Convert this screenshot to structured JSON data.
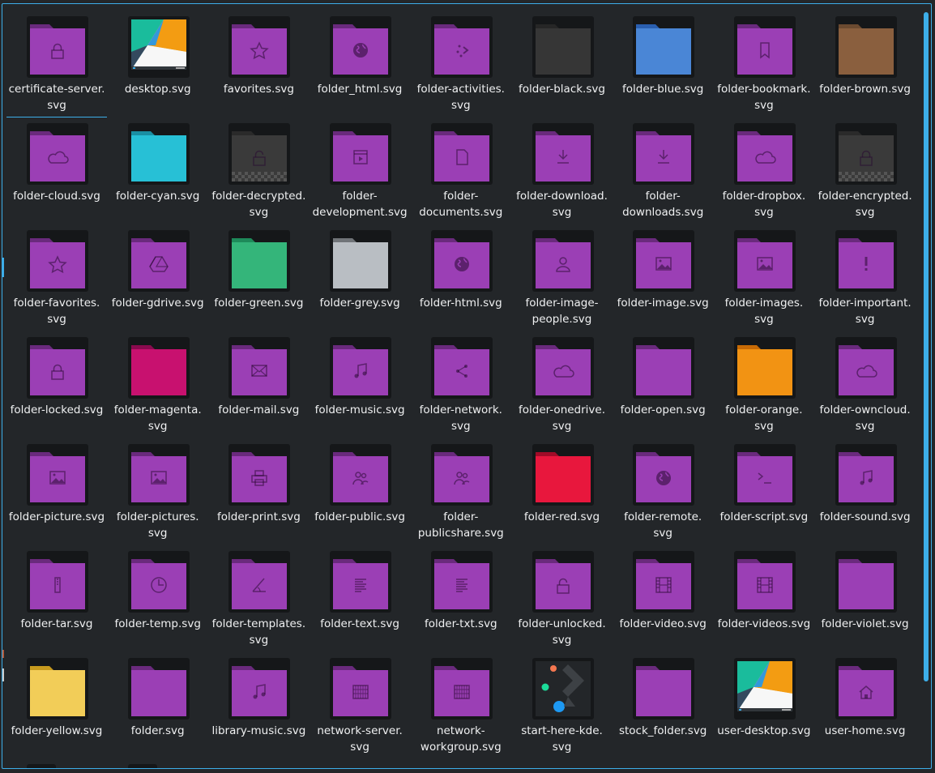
{
  "colors": {
    "accent": "#3daee9",
    "background": "#232629",
    "text": "#eff0f1",
    "violet_body": "#9b3fb5",
    "violet_tab": "#6a2a7d"
  },
  "icons": [
    {
      "label": "certificate-server.\nsvg",
      "icon": "lock",
      "color": "violet",
      "selected": true
    },
    {
      "label": "desktop.svg",
      "icon": "wallpaper"
    },
    {
      "label": "favorites.svg",
      "icon": "star",
      "color": "violet"
    },
    {
      "label": "folder_html.svg",
      "icon": "globe",
      "color": "violet"
    },
    {
      "label": "folder-activities.\nsvg",
      "icon": "activities",
      "color": "violet"
    },
    {
      "label": "folder-black.svg",
      "icon": "none",
      "color": "black"
    },
    {
      "label": "folder-blue.svg",
      "icon": "none",
      "color": "blue"
    },
    {
      "label": "folder-bookmark.\nsvg",
      "icon": "bookmark",
      "color": "violet"
    },
    {
      "label": "folder-brown.svg",
      "icon": "none",
      "color": "brown"
    },
    {
      "label": "folder-cloud.svg",
      "icon": "cloud",
      "color": "violet"
    },
    {
      "label": "folder-cyan.svg",
      "icon": "none",
      "color": "cyan"
    },
    {
      "label": "folder-decrypted.\nsvg",
      "icon": "unlock",
      "color": "checker"
    },
    {
      "label": "folder-\ndevelopment.svg",
      "icon": "development",
      "color": "violet"
    },
    {
      "label": "folder-\ndocuments.svg",
      "icon": "document",
      "color": "violet"
    },
    {
      "label": "folder-download.\nsvg",
      "icon": "download",
      "color": "violet"
    },
    {
      "label": "folder-\ndownloads.svg",
      "icon": "download",
      "color": "violet"
    },
    {
      "label": "folder-dropbox.\nsvg",
      "icon": "cloud",
      "color": "violet"
    },
    {
      "label": "folder-encrypted.\nsvg",
      "icon": "lock",
      "color": "checker"
    },
    {
      "label": "folder-favorites.\nsvg",
      "icon": "star",
      "color": "violet"
    },
    {
      "label": "folder-gdrive.svg",
      "icon": "gdrive",
      "color": "violet"
    },
    {
      "label": "folder-green.svg",
      "icon": "none",
      "color": "green"
    },
    {
      "label": "folder-grey.svg",
      "icon": "none",
      "color": "grey"
    },
    {
      "label": "folder-html.svg",
      "icon": "globe",
      "color": "violet"
    },
    {
      "label": "folder-image-\npeople.svg",
      "icon": "person",
      "color": "violet"
    },
    {
      "label": "folder-image.svg",
      "icon": "image",
      "color": "violet"
    },
    {
      "label": "folder-images.\nsvg",
      "icon": "image",
      "color": "violet"
    },
    {
      "label": "folder-important.\nsvg",
      "icon": "exclaim",
      "color": "violet"
    },
    {
      "label": "folder-locked.svg",
      "icon": "lock",
      "color": "violet"
    },
    {
      "label": "folder-magenta.\nsvg",
      "icon": "none",
      "color": "magenta"
    },
    {
      "label": "folder-mail.svg",
      "icon": "mail",
      "color": "violet"
    },
    {
      "label": "folder-music.svg",
      "icon": "music",
      "color": "violet"
    },
    {
      "label": "folder-network.\nsvg",
      "icon": "share",
      "color": "violet"
    },
    {
      "label": "folder-onedrive.\nsvg",
      "icon": "cloud",
      "color": "violet"
    },
    {
      "label": "folder-open.svg",
      "icon": "none",
      "color": "violet"
    },
    {
      "label": "folder-orange.\nsvg",
      "icon": "none",
      "color": "orange"
    },
    {
      "label": "folder-owncloud.\nsvg",
      "icon": "cloud",
      "color": "violet"
    },
    {
      "label": "folder-picture.svg",
      "icon": "image",
      "color": "violet"
    },
    {
      "label": "folder-pictures.\nsvg",
      "icon": "image",
      "color": "violet"
    },
    {
      "label": "folder-print.svg",
      "icon": "print",
      "color": "violet"
    },
    {
      "label": "folder-public.svg",
      "icon": "people",
      "color": "violet"
    },
    {
      "label": "folder-\npublicshare.svg",
      "icon": "people",
      "color": "violet"
    },
    {
      "label": "folder-red.svg",
      "icon": "none",
      "color": "red"
    },
    {
      "label": "folder-remote.\nsvg",
      "icon": "globe",
      "color": "violet"
    },
    {
      "label": "folder-script.svg",
      "icon": "terminal",
      "color": "violet"
    },
    {
      "label": "folder-sound.svg",
      "icon": "music",
      "color": "violet"
    },
    {
      "label": "folder-tar.svg",
      "icon": "zip",
      "color": "violet"
    },
    {
      "label": "folder-temp.svg",
      "icon": "clock",
      "color": "violet"
    },
    {
      "label": "folder-templates.\nsvg",
      "icon": "template",
      "color": "violet"
    },
    {
      "label": "folder-text.svg",
      "icon": "text",
      "color": "violet"
    },
    {
      "label": "folder-txt.svg",
      "icon": "text",
      "color": "violet"
    },
    {
      "label": "folder-unlocked.\nsvg",
      "icon": "unlock",
      "color": "violet"
    },
    {
      "label": "folder-video.svg",
      "icon": "film",
      "color": "violet"
    },
    {
      "label": "folder-videos.svg",
      "icon": "film",
      "color": "violet"
    },
    {
      "label": "folder-violet.svg",
      "icon": "none",
      "color": "violet"
    },
    {
      "label": "folder-yellow.svg",
      "icon": "none",
      "color": "yellow"
    },
    {
      "label": "folder.svg",
      "icon": "none",
      "color": "violet"
    },
    {
      "label": "library-music.svg",
      "icon": "music",
      "color": "violet"
    },
    {
      "label": "network-server.\nsvg",
      "icon": "server",
      "color": "violet"
    },
    {
      "label": "network-\nworkgroup.svg",
      "icon": "server",
      "color": "violet"
    },
    {
      "label": "start-here-kde.\nsvg",
      "icon": "kde"
    },
    {
      "label": "stock_folder.svg",
      "icon": "none",
      "color": "violet"
    },
    {
      "label": "user-desktop.svg",
      "icon": "wallpaper"
    },
    {
      "label": "user-home.svg",
      "icon": "home",
      "color": "violet"
    }
  ]
}
